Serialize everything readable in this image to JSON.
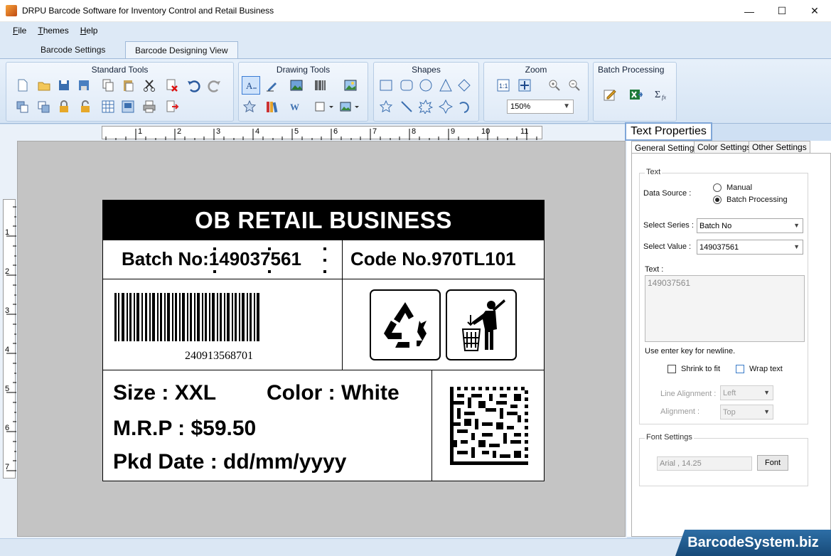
{
  "window": {
    "title": "DRPU Barcode Software for Inventory Control and Retail Business",
    "minimize": "—",
    "maximize": "☐",
    "close": "✕"
  },
  "menu": {
    "file_prefix": "F",
    "file_rest": "ile",
    "themes_prefix": "T",
    "themes_rest": "hemes",
    "help_prefix": "H",
    "help_rest": "elp"
  },
  "tabs": [
    {
      "label": "Barcode Settings",
      "active": false
    },
    {
      "label": "Barcode Designing View",
      "active": true
    }
  ],
  "ribbon": {
    "standard_tools": "Standard Tools",
    "drawing_tools": "Drawing Tools",
    "shapes": "Shapes",
    "zoom": "Zoom",
    "batch_processing": "Batch Processing",
    "zoom_value": "150%"
  },
  "ruler": {
    "h_ticks": [
      "1",
      "2",
      "3",
      "4",
      "5",
      "6",
      "7",
      "8",
      "9",
      "10",
      "11"
    ],
    "v_ticks": [
      "1",
      "2",
      "3",
      "4",
      "5",
      "6",
      "7"
    ]
  },
  "label": {
    "header": "OB RETAIL BUSINESS",
    "batch": "Batch No:149037561",
    "code": "Code No.970TL101",
    "barcode_number": "240913568701",
    "size": "Size : XXL",
    "color": "Color : White",
    "mrp": "M.R.P : $59.50",
    "pkd": "Pkd Date : dd/mm/yyyy"
  },
  "properties": {
    "title": "Text Properties",
    "tabs": [
      "General Settings",
      "Color Settings",
      "Other Settings"
    ],
    "text_group": "Text",
    "data_source_label": "Data Source :",
    "manual": "Manual",
    "batch_processing": "Batch Processing",
    "select_series_label": "Select Series :",
    "select_series_value": "Batch No",
    "select_value_label": "Select Value :",
    "select_value_value": "149037561",
    "text_label": "Text :",
    "text_value": "149037561",
    "hint": "Use enter key for newline.",
    "shrink_to_fit": "Shrink to fit",
    "wrap_text": "Wrap text",
    "line_alignment_label": "Line Alignment :",
    "line_alignment_value": "Left",
    "alignment_label": "Alignment :",
    "alignment_value": "Top",
    "font_group": "Font Settings",
    "font_value": "Arial , 14.25",
    "font_button": "Font"
  },
  "watermark": "BarcodeSystem.biz"
}
